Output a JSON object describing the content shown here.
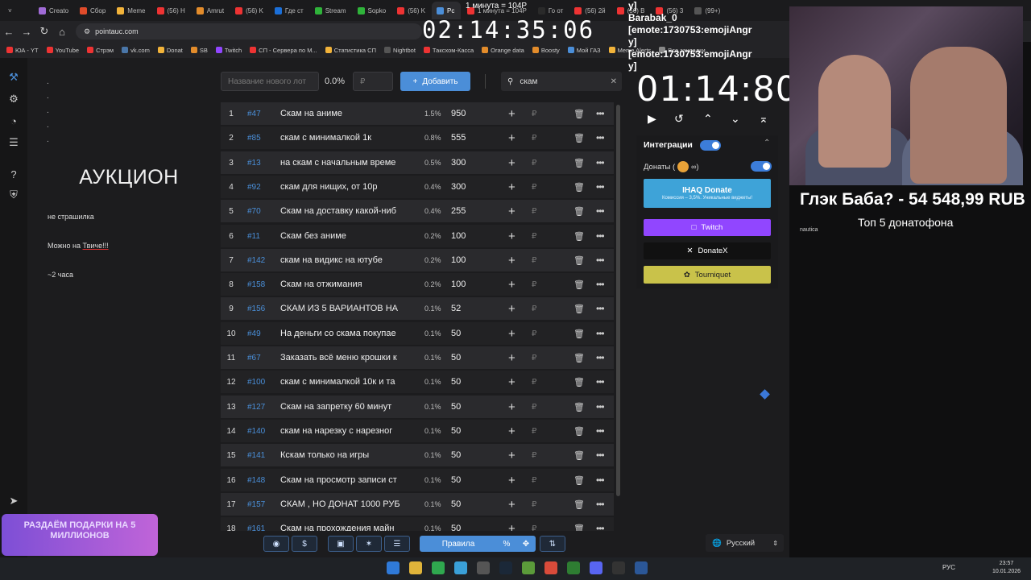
{
  "browser": {
    "tabs": [
      "Creato",
      "Сбор",
      "Meme",
      "(56) H",
      "Amrut",
      "(56) K",
      "Где ст",
      "Stream",
      "Sopko",
      "(56) K",
      "Pc",
      "1 минута = 104Р",
      "Го от",
      "(56) 2й",
      "(56) B",
      "(56) 3",
      "(99+)"
    ],
    "active_tab": "Pc",
    "url": "pointauc.com",
    "bookmarks": [
      "ЮА - YT",
      "YouTube",
      "Стрэм",
      "vk.com",
      "Donat",
      "SB",
      "Twitch",
      "СП - Сервера по М...",
      "Статистика СП",
      "Nightbot",
      "Таксхом-Касса",
      "Orange data",
      "Boosty",
      "Мой ГАЗ",
      "Meme Alerts",
      "Все закладки"
    ]
  },
  "left_panel": {
    "dots": [
      ".",
      ".",
      ".",
      ".",
      "."
    ],
    "title": "АУКЦИОН",
    "notes": [
      "не страшилка",
      "Можно на",
      "Твиче!!!",
      "~2 часа"
    ]
  },
  "toolbar": {
    "lot_placeholder": "Название нового лот",
    "percent": "0.0%",
    "amount_placeholder": "₽",
    "add_label": "Добавить",
    "search_value": "скам"
  },
  "lots": [
    {
      "idx": "1",
      "id": "#47",
      "name": "Скам на аниме",
      "pct": "1.5%",
      "amount": "950"
    },
    {
      "idx": "2",
      "id": "#85",
      "name": "скам с минималкой 1к",
      "pct": "0.8%",
      "amount": "555"
    },
    {
      "idx": "3",
      "id": "#13",
      "name": "на скам с начальным време",
      "pct": "0.5%",
      "amount": "300"
    },
    {
      "idx": "4",
      "id": "#92",
      "name": "скам для нищих, от 10р",
      "pct": "0.4%",
      "amount": "300"
    },
    {
      "idx": "5",
      "id": "#70",
      "name": "Скам на доставку какой-ниб",
      "pct": "0.4%",
      "amount": "255"
    },
    {
      "idx": "6",
      "id": "#11",
      "name": "Скам без аниме",
      "pct": "0.2%",
      "amount": "100"
    },
    {
      "idx": "7",
      "id": "#142",
      "name": "скам на видикс на ютубе",
      "pct": "0.2%",
      "amount": "100"
    },
    {
      "idx": "8",
      "id": "#158",
      "name": "Скам на отжимания",
      "pct": "0.2%",
      "amount": "100"
    },
    {
      "idx": "9",
      "id": "#156",
      "name": "СКАМ ИЗ 5 ВАРИАНТОВ НА",
      "pct": "0.1%",
      "amount": "52"
    },
    {
      "idx": "10",
      "id": "#49",
      "name": "На деньги со скама покупае",
      "pct": "0.1%",
      "amount": "50"
    },
    {
      "idx": "11",
      "id": "#67",
      "name": "Заказать всё меню крошки к",
      "pct": "0.1%",
      "amount": "50"
    },
    {
      "idx": "12",
      "id": "#100",
      "name": "скам с минималкой 10к и та",
      "pct": "0.1%",
      "amount": "50"
    },
    {
      "idx": "13",
      "id": "#127",
      "name": "Скам на запретку 60 минут",
      "pct": "0.1%",
      "amount": "50"
    },
    {
      "idx": "14",
      "id": "#140",
      "name": "скам на нарезку с нарезног",
      "pct": "0.1%",
      "amount": "50"
    },
    {
      "idx": "15",
      "id": "#141",
      "name": "Кскам только на игры",
      "pct": "0.1%",
      "amount": "50"
    },
    {
      "idx": "16",
      "id": "#148",
      "name": "Скам на просмотр записи ст",
      "pct": "0.1%",
      "amount": "50"
    },
    {
      "idx": "17",
      "id": "#157",
      "name": "СКАМ , НО ДОНАТ 1000 РУБ",
      "pct": "0.1%",
      "amount": "50"
    },
    {
      "idx": "18",
      "id": "#161",
      "name": "Скам на прохождения майн",
      "pct": "0.1%",
      "amount": "50"
    }
  ],
  "list_symbols": {
    "plus": "+",
    "rub": "₽",
    "trash": "🗑",
    "more": "•••"
  },
  "bottom_bar": {
    "rules_label": "Правила",
    "percent_symbol": "%",
    "dollar_symbol": "$"
  },
  "right_panel": {
    "timer": "01:14:80",
    "integrations_label": "Интеграции",
    "donations_label": "Донаты (",
    "ihaq_label": "IHAQ Donate",
    "ihaq_sub": "Комиссия – 3,5%. Уникальные виджеты!",
    "twitch_label": "Twitch",
    "donatex_label": "DonateX",
    "tourniquet_label": "Tourniquet",
    "language": "Русский"
  },
  "overlay": {
    "big_timer": "02:14:35:06",
    "minute_price": "1 минута = 104Р",
    "chat_lines": [
      "у]",
      "Barabak_0  [emote:1730753:emojiAngr",
      "у]",
      "[emote:1730753:emojiAngr",
      "у]"
    ],
    "donation_text": "Глэк Баба? - 54 548,99 RUB",
    "top_donators": "Топ  5 донатофона",
    "nautica": "nautica",
    "banner_text": "РАЗДАЁМ ПОДАРКИ НА 5 МИЛЛИОНОВ"
  },
  "taskbar": {
    "lang": "РУС",
    "time": "23:57",
    "date": "10.01.2026"
  },
  "colors": {
    "accent": "#4b8ed8",
    "twitch": "#9146ff",
    "donatex": "#111111",
    "tourniquet": "#c9c24a",
    "ihaq": "#3ea3d8"
  }
}
